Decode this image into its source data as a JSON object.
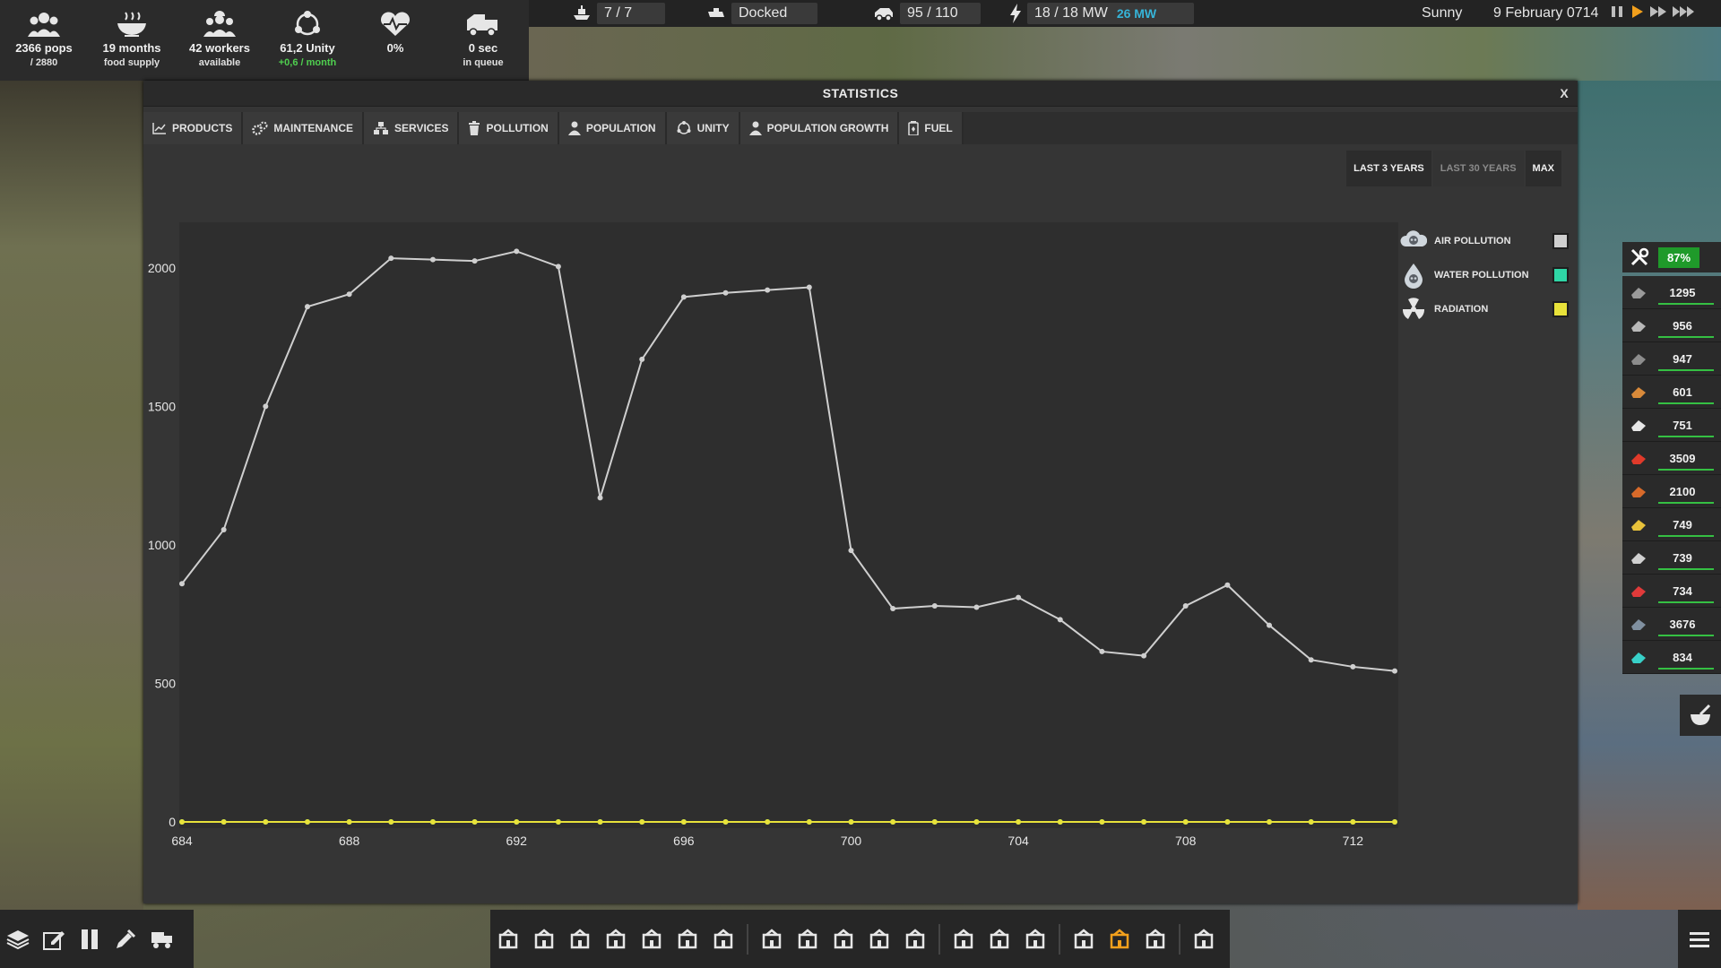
{
  "topstats": [
    {
      "icon": "population-icon",
      "line1": "2366 pops",
      "line2": "/ 2880"
    },
    {
      "icon": "food-icon",
      "line1": "19 months",
      "line2": "food supply"
    },
    {
      "icon": "workers-icon",
      "line1": "42 workers",
      "line2": "available"
    },
    {
      "icon": "unity-icon",
      "line1": "61,2 Unity",
      "line2": "+0,6 / month"
    },
    {
      "icon": "health-icon",
      "line1": "0%",
      "line2": ""
    },
    {
      "icon": "truck-icon",
      "line1": "0 sec",
      "line2": "in queue"
    }
  ],
  "infobar": {
    "ships": "7 / 7",
    "dock_status": "Docked",
    "vehicles": "95 / 110",
    "power": "18 / 18 MW",
    "power_extra": "26 MW",
    "weather": "Sunny",
    "date": "9 February 0714"
  },
  "window": {
    "title": "STATISTICS",
    "close_label": "X",
    "tabs": [
      {
        "label": "PRODUCTS",
        "icon": "chart-icon"
      },
      {
        "label": "MAINTENANCE",
        "icon": "gears-icon"
      },
      {
        "label": "SERVICES",
        "icon": "services-icon"
      },
      {
        "label": "POLLUTION",
        "icon": "trash-icon"
      },
      {
        "label": "POPULATION",
        "icon": "person-icon"
      },
      {
        "label": "UNITY",
        "icon": "unity-icon"
      },
      {
        "label": "POPULATION GROWTH",
        "icon": "person-icon"
      },
      {
        "label": "FUEL",
        "icon": "fuel-icon"
      }
    ],
    "range_buttons": [
      "LAST 3 YEARS",
      "LAST 30 YEARS",
      "MAX"
    ]
  },
  "legend": [
    {
      "name": "AIR POLLUTION",
      "color": "#cfcfcf",
      "icon": "skull-cloud-icon"
    },
    {
      "name": "WATER POLLUTION",
      "color": "#2fd6a6",
      "icon": "skull-drop-icon"
    },
    {
      "name": "RADIATION",
      "color": "#e8e23a",
      "icon": "radiation-icon"
    }
  ],
  "chart_data": {
    "type": "line",
    "ylim": [
      0,
      2100
    ],
    "yticks": [
      0,
      500,
      1000,
      1500,
      2000
    ],
    "xticks": [
      684,
      688,
      692,
      696,
      700,
      704,
      708,
      712
    ],
    "x": [
      684,
      685,
      686,
      687,
      688,
      689,
      690,
      691,
      692,
      693,
      694,
      695,
      696,
      697,
      698,
      699,
      700,
      701,
      702,
      703,
      704,
      705,
      706,
      707,
      708,
      709,
      710,
      711,
      712,
      713
    ],
    "series": [
      {
        "name": "AIR POLLUTION",
        "color": "#cfcfcf",
        "values": [
          860,
          1055,
          1500,
          1860,
          1905,
          2035,
          2030,
          2025,
          2060,
          2005,
          1170,
          1670,
          1895,
          1910,
          1920,
          1930,
          980,
          770,
          780,
          775,
          810,
          730,
          615,
          600,
          780,
          855,
          710,
          585,
          560,
          545
        ]
      },
      {
        "name": "WATER POLLUTION",
        "color": "#2fd6a6",
        "values": [
          0,
          0,
          0,
          0,
          0,
          0,
          0,
          0,
          0,
          0,
          0,
          0,
          0,
          0,
          0,
          0,
          0,
          0,
          0,
          0,
          0,
          0,
          0,
          0,
          0,
          0,
          0,
          0,
          0,
          0
        ]
      },
      {
        "name": "RADIATION",
        "color": "#e8e23a",
        "values": [
          0,
          0,
          0,
          0,
          0,
          0,
          0,
          0,
          0,
          0,
          0,
          0,
          0,
          0,
          0,
          0,
          0,
          0,
          0,
          0,
          0,
          0,
          0,
          0,
          0,
          0,
          0,
          0,
          0,
          0
        ]
      }
    ]
  },
  "maintenance": {
    "value": "87%"
  },
  "resources": [
    {
      "icon": "rock-icon",
      "value": "1295"
    },
    {
      "icon": "iron-icon",
      "value": "956"
    },
    {
      "icon": "concrete-icon",
      "value": "947"
    },
    {
      "icon": "wood-icon",
      "value": "601"
    },
    {
      "icon": "construction-parts-icon",
      "value": "751"
    },
    {
      "icon": "fuel-icon",
      "value": "3509"
    },
    {
      "icon": "food-icon",
      "value": "2100"
    },
    {
      "icon": "gold-parts-icon",
      "value": "749"
    },
    {
      "icon": "steel-icon",
      "value": "739"
    },
    {
      "icon": "red-parts-icon",
      "value": "734"
    },
    {
      "icon": "electronics-icon",
      "value": "3676"
    },
    {
      "icon": "glass-icon",
      "value": "834"
    }
  ],
  "bottom_tools": [
    "layers-icon",
    "edit-icon",
    "pause-icon",
    "eyedropper-icon",
    "transport-icon"
  ],
  "bottom_build": [
    "tower-icon",
    "water-icon",
    "farm-icon",
    "oil-icon",
    "power-icon",
    "fuel-icon",
    "recycle-icon",
    "storage-icon",
    "factory-icon",
    "factory2-icon",
    "warehouse-icon",
    "ship-icon",
    "excavator-icon",
    "bulldozer-icon",
    "rocket-icon",
    "mail-icon",
    "stats-icon",
    "research-icon",
    "settlement-icon"
  ],
  "menu_icon": "menu-icon"
}
